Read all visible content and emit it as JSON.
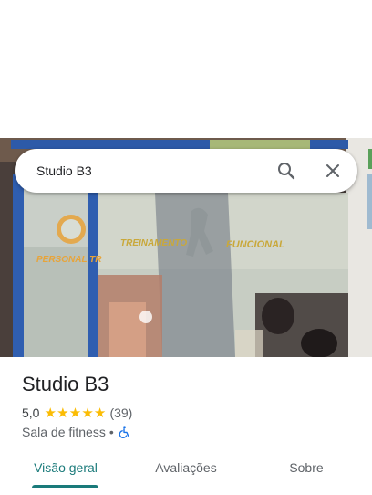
{
  "search": {
    "query": "Studio B3",
    "search_icon": "search-icon",
    "close_icon": "close-icon"
  },
  "hero": {
    "photo_sign_text_1": "PERSONAL TR",
    "photo_sign_text_2": "TREINAMENTO",
    "photo_sign_text_3": "FUNCIONAL"
  },
  "place": {
    "name": "Studio B3",
    "rating": "5,0",
    "stars": 5,
    "review_count": "(39)",
    "category": "Sala de fitness",
    "separator": "•",
    "accessibility_icon": "wheelchair-icon"
  },
  "tabs": [
    {
      "label": "Visão geral",
      "selected": true
    },
    {
      "label": "Avaliações",
      "selected": false
    },
    {
      "label": "Sobre",
      "selected": false
    }
  ],
  "colors": {
    "accent": "#1a7a7a",
    "star": "#fbbc04",
    "accessibility": "#1a73e8"
  }
}
